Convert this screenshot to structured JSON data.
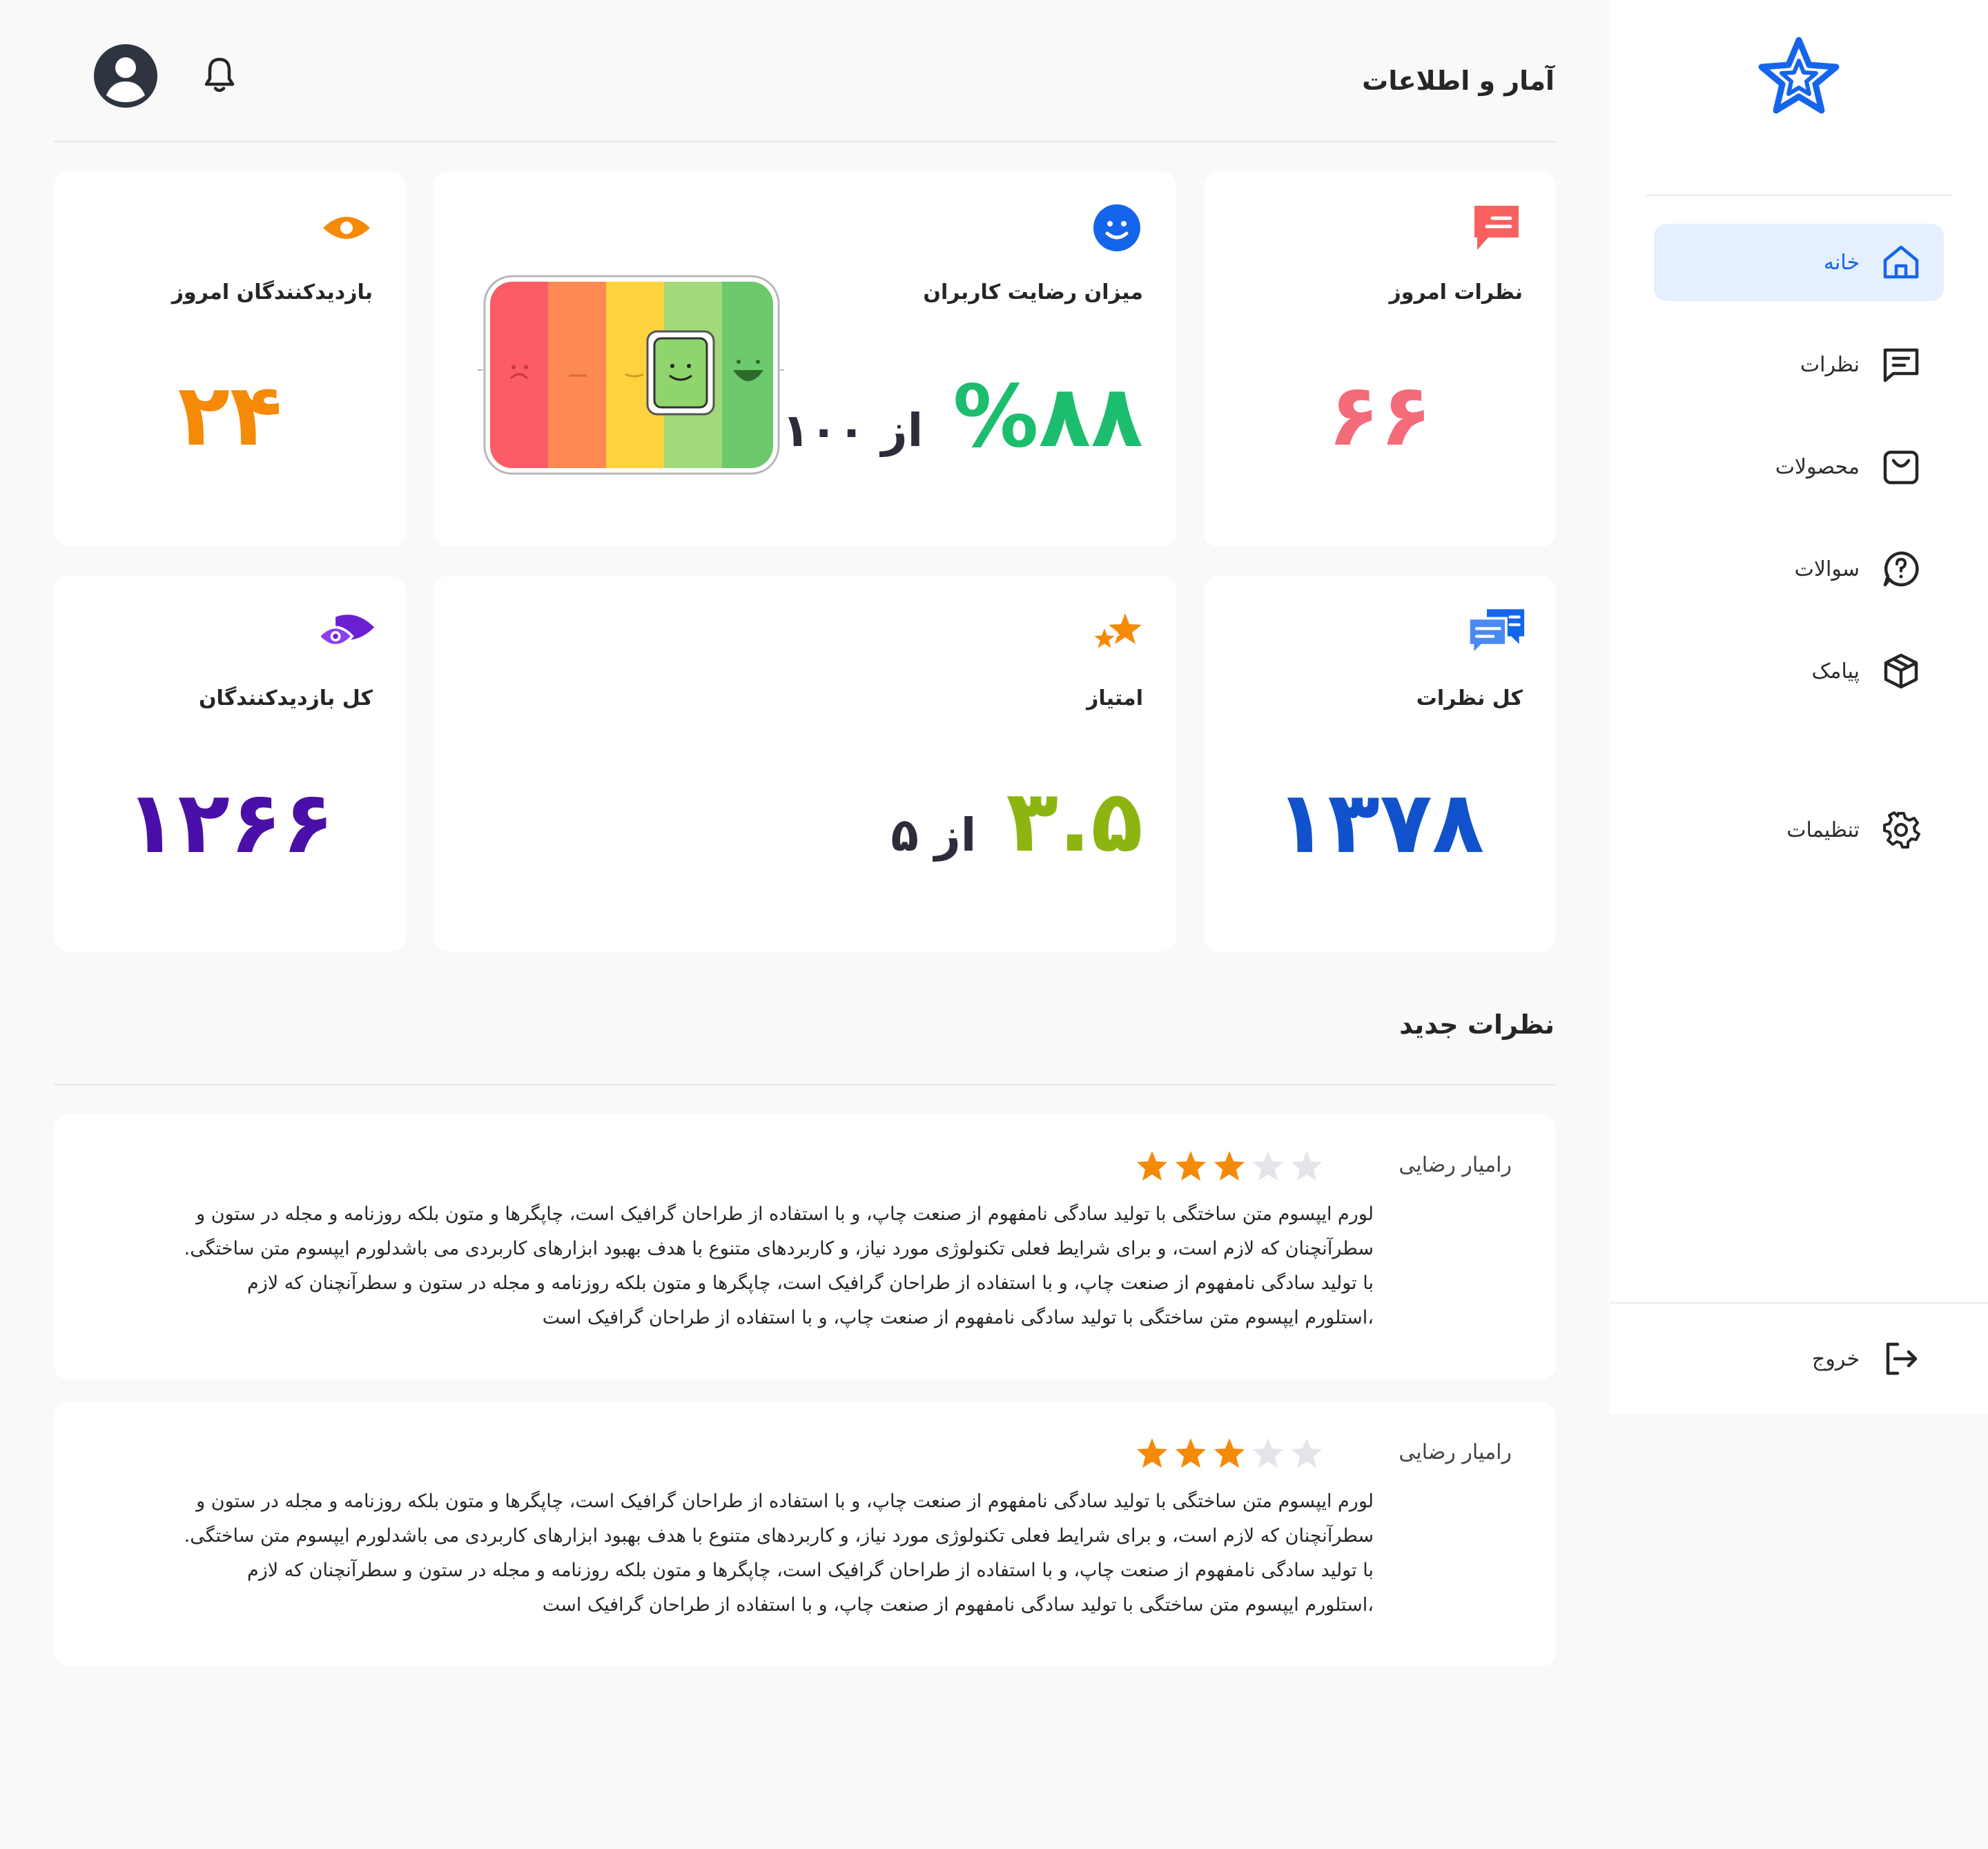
{
  "header": {
    "title": "آمار و اطلاعات"
  },
  "sidebar": {
    "items": [
      {
        "label": "خانه",
        "icon": "home-icon",
        "active": true
      },
      {
        "label": "نظرات",
        "icon": "comment-icon",
        "active": false
      },
      {
        "label": "محصولات",
        "icon": "basket-icon",
        "active": false
      },
      {
        "label": "سوالات",
        "icon": "question-icon",
        "active": false
      },
      {
        "label": "پیامک",
        "icon": "box-icon",
        "active": false
      },
      {
        "label": "تنظیمات",
        "icon": "gear-icon",
        "active": false
      }
    ],
    "logout": "خروج"
  },
  "stats": {
    "today_comments": {
      "title": "نظرات امروز",
      "value": "۶۶",
      "color": "#f46b7a"
    },
    "satisfaction": {
      "title": "میزان رضایت کاربران",
      "value": "%۸۸",
      "suffix": "از ۱۰۰",
      "color": "#1dbd6e",
      "percent": 88
    },
    "today_visitors": {
      "title": "بازدیدکنندگان امروز",
      "value": "۲۴",
      "color": "#f58a07"
    },
    "total_comments": {
      "title": "کل نظرات",
      "value": "۱۳۷۸",
      "color": "#1152cc"
    },
    "rating": {
      "title": "امتیاز",
      "value": "۳.۵",
      "suffix": "از ۵",
      "color": "#8db512"
    },
    "total_visitors": {
      "title": "کل بازدیدکنندگان",
      "value": "۱۲۶۶",
      "color": "#4a0fa8"
    }
  },
  "colors": {
    "accent": "#1565ea",
    "star_filled": "#f58a07",
    "star_empty": "#e4e5ea"
  },
  "new_comments": {
    "title": "نظرات جدید",
    "reviews": [
      {
        "name": "رامیار رضایی",
        "rating": 3,
        "lines": [
          "لورم ایپسوم متن ساختگی با تولید سادگی نامفهوم از صنعت چاپ، و با استفاده از طراحان گرافیک است، چاپگرها و متون بلکه روزنامه و مجله در ستون و",
          "سطرآنچنان که لازم است، و برای شرایط فعلی تکنولوژی مورد نیاز، و کاربردهای متنوع با هدف بهبود ابزارهای کاربردی می باشدلورم ایپسوم متن ساختگی.",
          "با تولید سادگی نامفهوم از صنعت چاپ، و با استفاده از طراحان گرافیک است، چاپگرها و متون بلکه روزنامه و مجله در ستون و سطرآنچنان که لازم",
          "،استلورم ایپسوم متن ساختگی با تولید سادگی نامفهوم از صنعت چاپ، و با استفاده از طراحان گرافیک است"
        ]
      },
      {
        "name": "رامیار رضایی",
        "rating": 3,
        "lines": [
          "لورم ایپسوم متن ساختگی با تولید سادگی نامفهوم از صنعت چاپ، و با استفاده از طراحان گرافیک است، چاپگرها و متون بلکه روزنامه و مجله در ستون و",
          "سطرآنچنان که لازم است، و برای شرایط فعلی تکنولوژی مورد نیاز، و کاربردهای متنوع با هدف بهبود ابزارهای کاربردی می باشدلورم ایپسوم متن ساختگی.",
          "با تولید سادگی نامفهوم از صنعت چاپ، و با استفاده از طراحان گرافیک است، چاپگرها و متون بلکه روزنامه و مجله در ستون و سطرآنچنان که لازم",
          "،استلورم ایپسوم متن ساختگی با تولید سادگی نامفهوم از صنعت چاپ، و با استفاده از طراحان گرافیک است"
        ]
      }
    ]
  }
}
